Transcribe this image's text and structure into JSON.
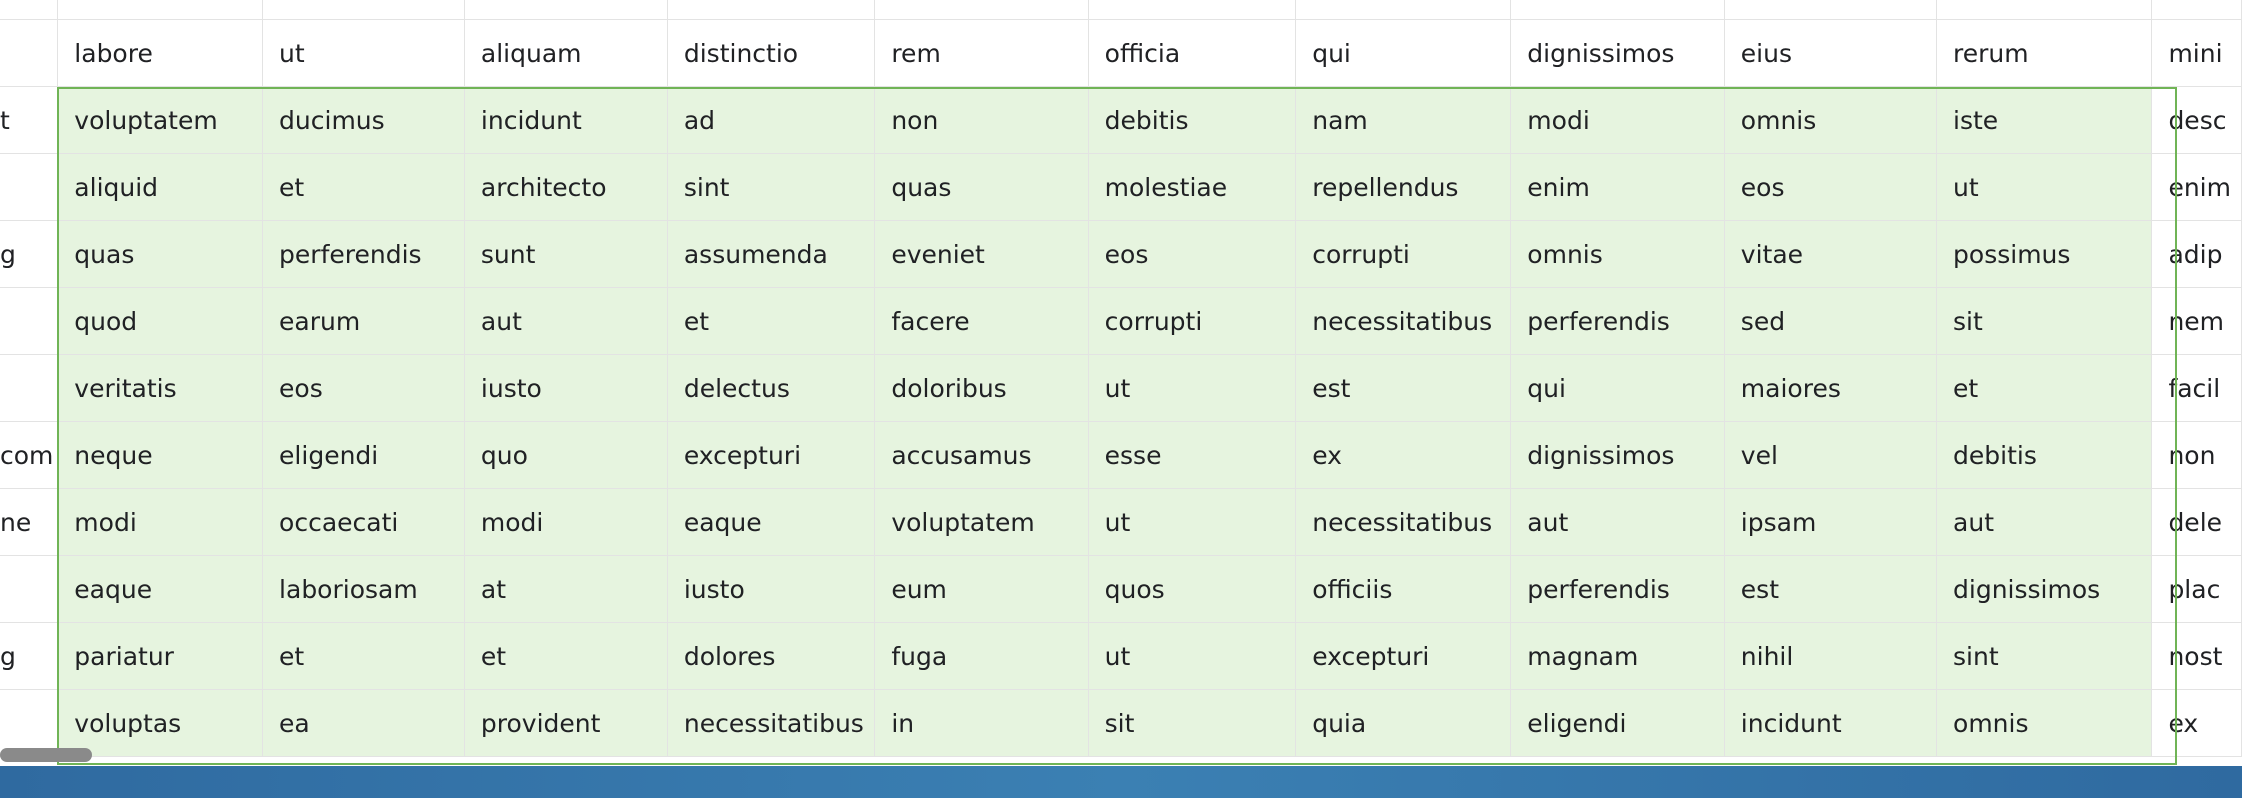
{
  "row_labels": [
    "",
    "t",
    "",
    "g",
    "",
    "",
    "com",
    "ne",
    "",
    "g",
    ""
  ],
  "columns": [
    "labore",
    "ut",
    "aliquam",
    "distinctio",
    "rem",
    "officia",
    "qui",
    "dignissimos",
    "eius",
    "rerum",
    "mini"
  ],
  "rows": [
    [
      "voluptatem",
      "ducimus",
      "incidunt",
      "ad",
      "non",
      "debitis",
      "nam",
      "modi",
      "omnis",
      "iste",
      "desc"
    ],
    [
      "aliquid",
      "et",
      "architecto",
      "sint",
      "quas",
      "molestiae",
      "repellendus",
      "enim",
      "eos",
      "ut",
      "enim"
    ],
    [
      "quas",
      "perferendis",
      "sunt",
      "assumenda",
      "eveniet",
      "eos",
      "corrupti",
      "omnis",
      "vitae",
      "possimus",
      "adip"
    ],
    [
      "quod",
      "earum",
      "aut",
      "et",
      "facere",
      "corrupti",
      "necessitatibus",
      "perferendis",
      "sed",
      "sit",
      "nem"
    ],
    [
      "veritatis",
      "eos",
      "iusto",
      "delectus",
      "doloribus",
      "ut",
      "est",
      "qui",
      "maiores",
      "et",
      "facil"
    ],
    [
      "neque",
      "eligendi",
      "quo",
      "excepturi",
      "accusamus",
      "esse",
      "ex",
      "dignissimos",
      "vel",
      "debitis",
      "non"
    ],
    [
      "modi",
      "occaecati",
      "modi",
      "eaque",
      "voluptatem",
      "ut",
      "necessitatibus",
      "aut",
      "ipsam",
      "aut",
      "dele"
    ],
    [
      "eaque",
      "laboriosam",
      "at",
      "iusto",
      "eum",
      "quos",
      "officiis",
      "perferendis",
      "est",
      "dignissimos",
      "plac"
    ],
    [
      "pariatur",
      "et",
      "et",
      "dolores",
      "fuga",
      "ut",
      "excepturi",
      "magnam",
      "nihil",
      "sint",
      "nost"
    ],
    [
      "voluptas",
      "ea",
      "provident",
      "necessitatibus",
      "in",
      "sit",
      "quia",
      "eligendi",
      "incidunt",
      "omnis",
      "ex"
    ]
  ],
  "colors": {
    "selection_fill": "#e6f4df",
    "selection_border": "#70b456",
    "gridline": "#e3e3e3",
    "taskbar": "#3b80b3",
    "scrollbar": "#8a8a8a"
  }
}
